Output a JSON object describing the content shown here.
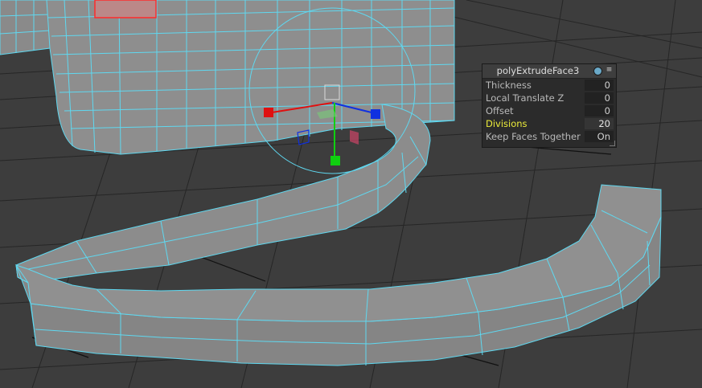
{
  "panel": {
    "title": "polyExtrudeFace3",
    "pin_icon": "pin-icon",
    "menu_icon": "menu-icon",
    "rows": [
      {
        "label": "Thickness",
        "value": "0",
        "active": false
      },
      {
        "label": "Local Translate Z",
        "value": "0",
        "active": false
      },
      {
        "label": "Offset",
        "value": "0",
        "active": false
      },
      {
        "label": "Divisions",
        "value": "20",
        "active": true
      },
      {
        "label": "Keep Faces Together",
        "value": "On",
        "active": false
      }
    ]
  },
  "colors": {
    "viewport_bg": "#3c3c3c",
    "grid": "#222222",
    "mesh_fill": "#8a8a8a",
    "mesh_wire": "#5fd8f0",
    "selected_face": "#ff2a2a",
    "highlight_label": "#ecec3a",
    "manip_x": "#e01010",
    "manip_y": "#10d010",
    "manip_z": "#1030e0"
  }
}
